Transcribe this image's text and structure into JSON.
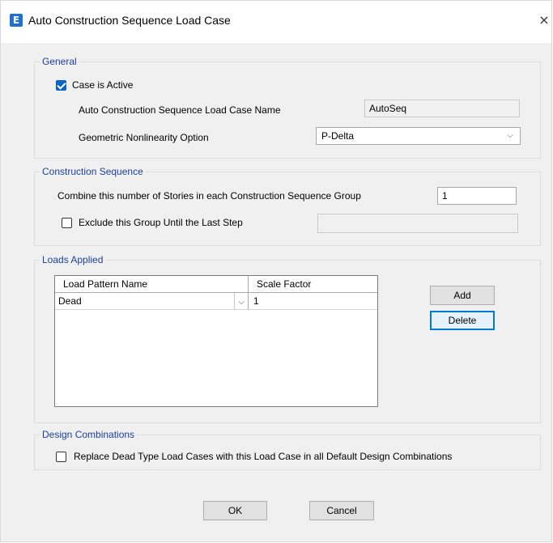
{
  "window": {
    "title": "Auto Construction Sequence Load Case",
    "app_icon": "E",
    "close_glyph": "×"
  },
  "general": {
    "legend": "General",
    "case_active_label": "Case is Active",
    "case_active_checked": true,
    "name_label": "Auto Construction Sequence Load Case Name",
    "name_value": "AutoSeq",
    "geom_label": "Geometric Nonlinearity Option",
    "geom_value": "P-Delta"
  },
  "construction": {
    "legend": "Construction Sequence",
    "combine_label": "Combine this number of Stories in each Construction Sequence Group",
    "combine_value": "1",
    "exclude_label": "Exclude this Group Until the Last Step",
    "exclude_checked": false,
    "exclude_value": ""
  },
  "loads": {
    "legend": "Loads Applied",
    "columns": [
      "Load Pattern Name",
      "Scale Factor"
    ],
    "rows": [
      {
        "pattern": "Dead",
        "scale": "1"
      }
    ],
    "add_label": "Add",
    "delete_label": "Delete"
  },
  "design": {
    "legend": "Design Combinations",
    "replace_label": "Replace Dead Type Load Cases with this Load Case in all Default Design Combinations",
    "replace_checked": false
  },
  "footer": {
    "ok_label": "OK",
    "cancel_label": "Cancel"
  },
  "colors": {
    "accent": "#0a64c8",
    "legend_text": "#1a3f9c",
    "app_icon_bg": "#1e6fd1"
  }
}
